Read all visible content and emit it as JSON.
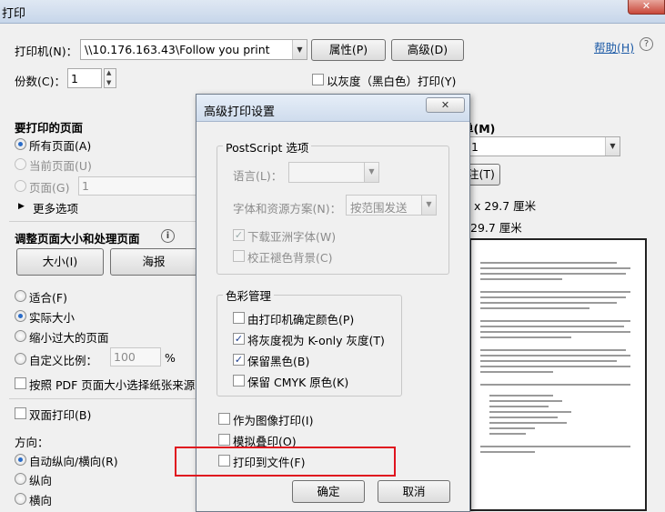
{
  "window": {
    "title": "打印",
    "close_glyph": "✕"
  },
  "printer": {
    "label": "打印机(N)：",
    "value": "\\\\10.176.163.43\\Follow you print",
    "properties_button": "属性(P)",
    "advanced_button": "高级(D)",
    "help_link": "帮助(H)"
  },
  "copies": {
    "label": "份数(C)：",
    "value": "1"
  },
  "grayscale": {
    "label": "以灰度（黑白色）打印(Y)",
    "checked": false
  },
  "pages": {
    "heading": "要打印的页面",
    "all": "所有页面(A)",
    "current": "当前页面(U)",
    "range": "页面(G)",
    "range_value": "1",
    "more": "更多选项"
  },
  "sizing": {
    "heading": "调整页面大小和处理页面",
    "size_button": "大小(I)",
    "poster_button": "海报",
    "fit": "适合(F)",
    "actual": "实际大小",
    "shrink": "缩小过大的页面",
    "custom": "自定义比例：",
    "custom_value": "100",
    "percent": "%",
    "pdf_source": "按照 PDF 页面大小选择纸张来源(Z)"
  },
  "duplex": {
    "label": "双面打印(B)"
  },
  "orientation": {
    "heading": "方向：",
    "auto": "自动纵向/横向(R)",
    "portrait": "纵向",
    "landscape": "横向"
  },
  "right_panel": {
    "heading_fragment": "单(M)",
    "combo_fragment": "1",
    "button_fragment": "注(T)",
    "size_line1": "x 29.7 厘米",
    "size_line2": "29.7 厘米"
  },
  "dialog": {
    "title": "高级打印设置",
    "close_glyph": "✕",
    "postscript": {
      "title": "PostScript 选项",
      "language_label": "语言(L)：",
      "language_value": "",
      "font_label": "字体和资源方案(N)：",
      "font_value": "按范围发送",
      "download_asian": "下载亚洲字体(W)",
      "correct_gray": "校正褪色背景(C)"
    },
    "color": {
      "title": "色彩管理",
      "printer_color": "由打印机确定颜色(P)",
      "konly": "将灰度视为 K-only 灰度(T)",
      "preserve_black": "保留黑色(B)",
      "preserve_cmyk": "保留 CMYK 原色(K)"
    },
    "as_image": "作为图像打印(I)",
    "simulate_overprint": "模拟叠印(O)",
    "print_to_file": "打印到文件(F)",
    "ok_button": "确定",
    "cancel_button": "取消"
  },
  "icons": {
    "help": "?",
    "info": "i",
    "arrow_up": "▲",
    "arrow_down": "▼",
    "triangle_right": "▶",
    "check": "✓"
  }
}
